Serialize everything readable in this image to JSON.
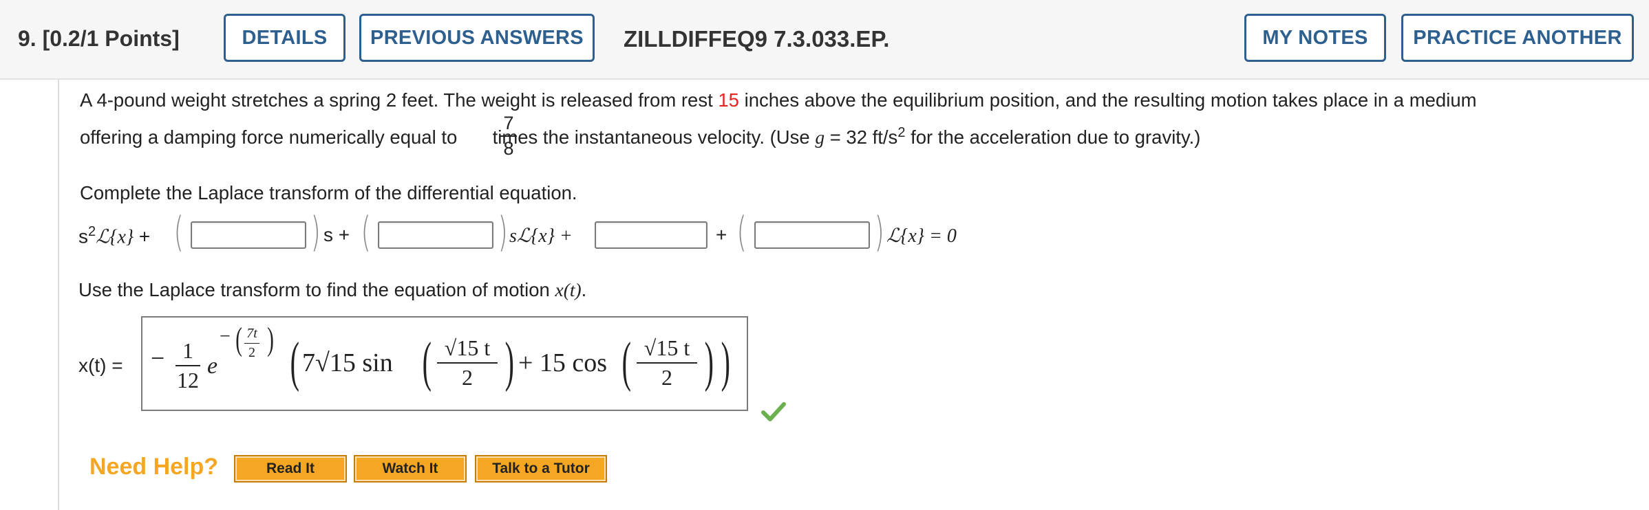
{
  "header": {
    "question_number": "9. [0.2/1 Points]",
    "details_label": "DETAILS",
    "previous_answers_label": "PREVIOUS ANSWERS",
    "question_code": "ZILLDIFFEQ9 7.3.033.EP.",
    "my_notes_label": "MY NOTES",
    "practice_another_label": "PRACTICE ANOTHER"
  },
  "problem": {
    "line1_a": "A 4-pound weight stretches a spring 2 feet. The weight is released from rest",
    "line1_value": "15",
    "line1_b": "inches above the equilibrium position, and the resulting motion takes place in a medium",
    "line2_a": "offering a damping force numerically equal to",
    "frac_num": "7",
    "frac_den": "8",
    "line2_b": "times the instantaneous velocity. (Use",
    "g_symbol": "g",
    "line2_c": "= 32 ft/s",
    "line2_exp": "2",
    "line2_d": "for the acceleration due to gravity.)"
  },
  "part1": {
    "instruction": "Complete the Laplace transform of the differential equation.",
    "s2": "s",
    "s2_exp": "2",
    "L_x": "ℒ{x}",
    "plus1": "+",
    "s_plus": "s +",
    "sLx_plus": "sℒ{x} +",
    "plus2": "+",
    "Lx_eq": "ℒ{x} = 0",
    "inputs": [
      "",
      "",
      "",
      ""
    ]
  },
  "part2": {
    "instruction_a": "Use the Laplace transform to find the equation of motion",
    "instruction_var": "x(t)",
    "instruction_end": ".",
    "label": "x(t) =",
    "answer": {
      "neg": "−",
      "coef_num": "1",
      "coef_den": "12",
      "e": "e",
      "exp_neg": "−",
      "exp_num": "7t",
      "exp_den": "2",
      "term1": "7√15 sin",
      "arg_num": "√15 t",
      "arg_den": "2",
      "plus": "+ 15 cos",
      "arg2_num": "√15 t",
      "arg2_den": "2"
    },
    "status": "correct"
  },
  "help": {
    "label": "Need Help?",
    "read_it": "Read It",
    "watch_it": "Watch It",
    "talk_to_tutor": "Talk to a Tutor"
  },
  "colors": {
    "accent": "#2d5f8f",
    "highlight_red": "#e2261d",
    "help_orange": "#f5a623",
    "check_green": "#6ab04c"
  }
}
